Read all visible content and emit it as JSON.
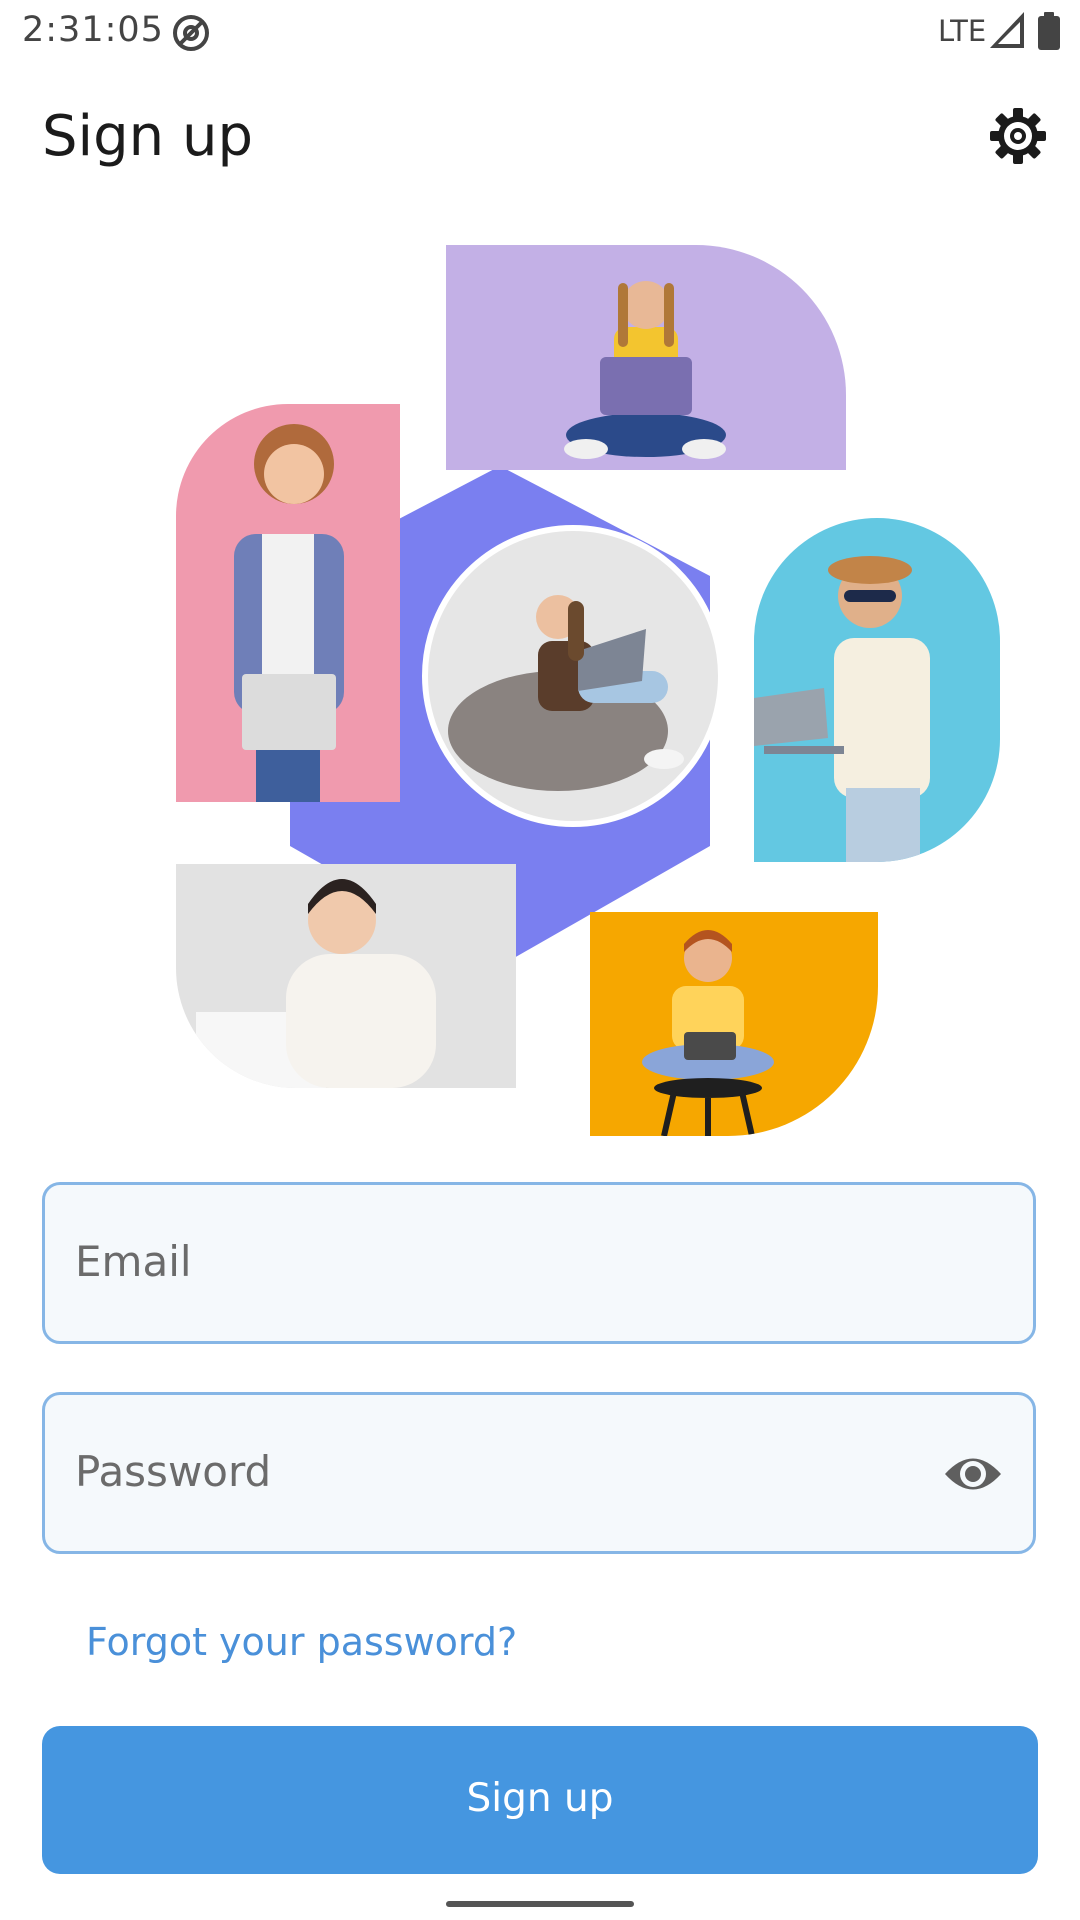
{
  "status_bar": {
    "time": "2:31:05",
    "network": "LTE"
  },
  "app_bar": {
    "title": "Sign up"
  },
  "icons": {
    "status_app": "at-sign-icon",
    "signal": "signal-icon",
    "battery": "battery-icon",
    "settings": "gear-icon",
    "password_toggle": "eye-icon"
  },
  "form": {
    "email": {
      "placeholder": "Email",
      "value": ""
    },
    "password": {
      "placeholder": "Password",
      "value": ""
    },
    "forgot_link": "Forgot your password?",
    "submit_label": "Sign up"
  },
  "colors": {
    "accent": "#4596e0",
    "field_border": "#86b6e6",
    "link": "#4a90d9",
    "hexagon": "#7a7ff0"
  }
}
